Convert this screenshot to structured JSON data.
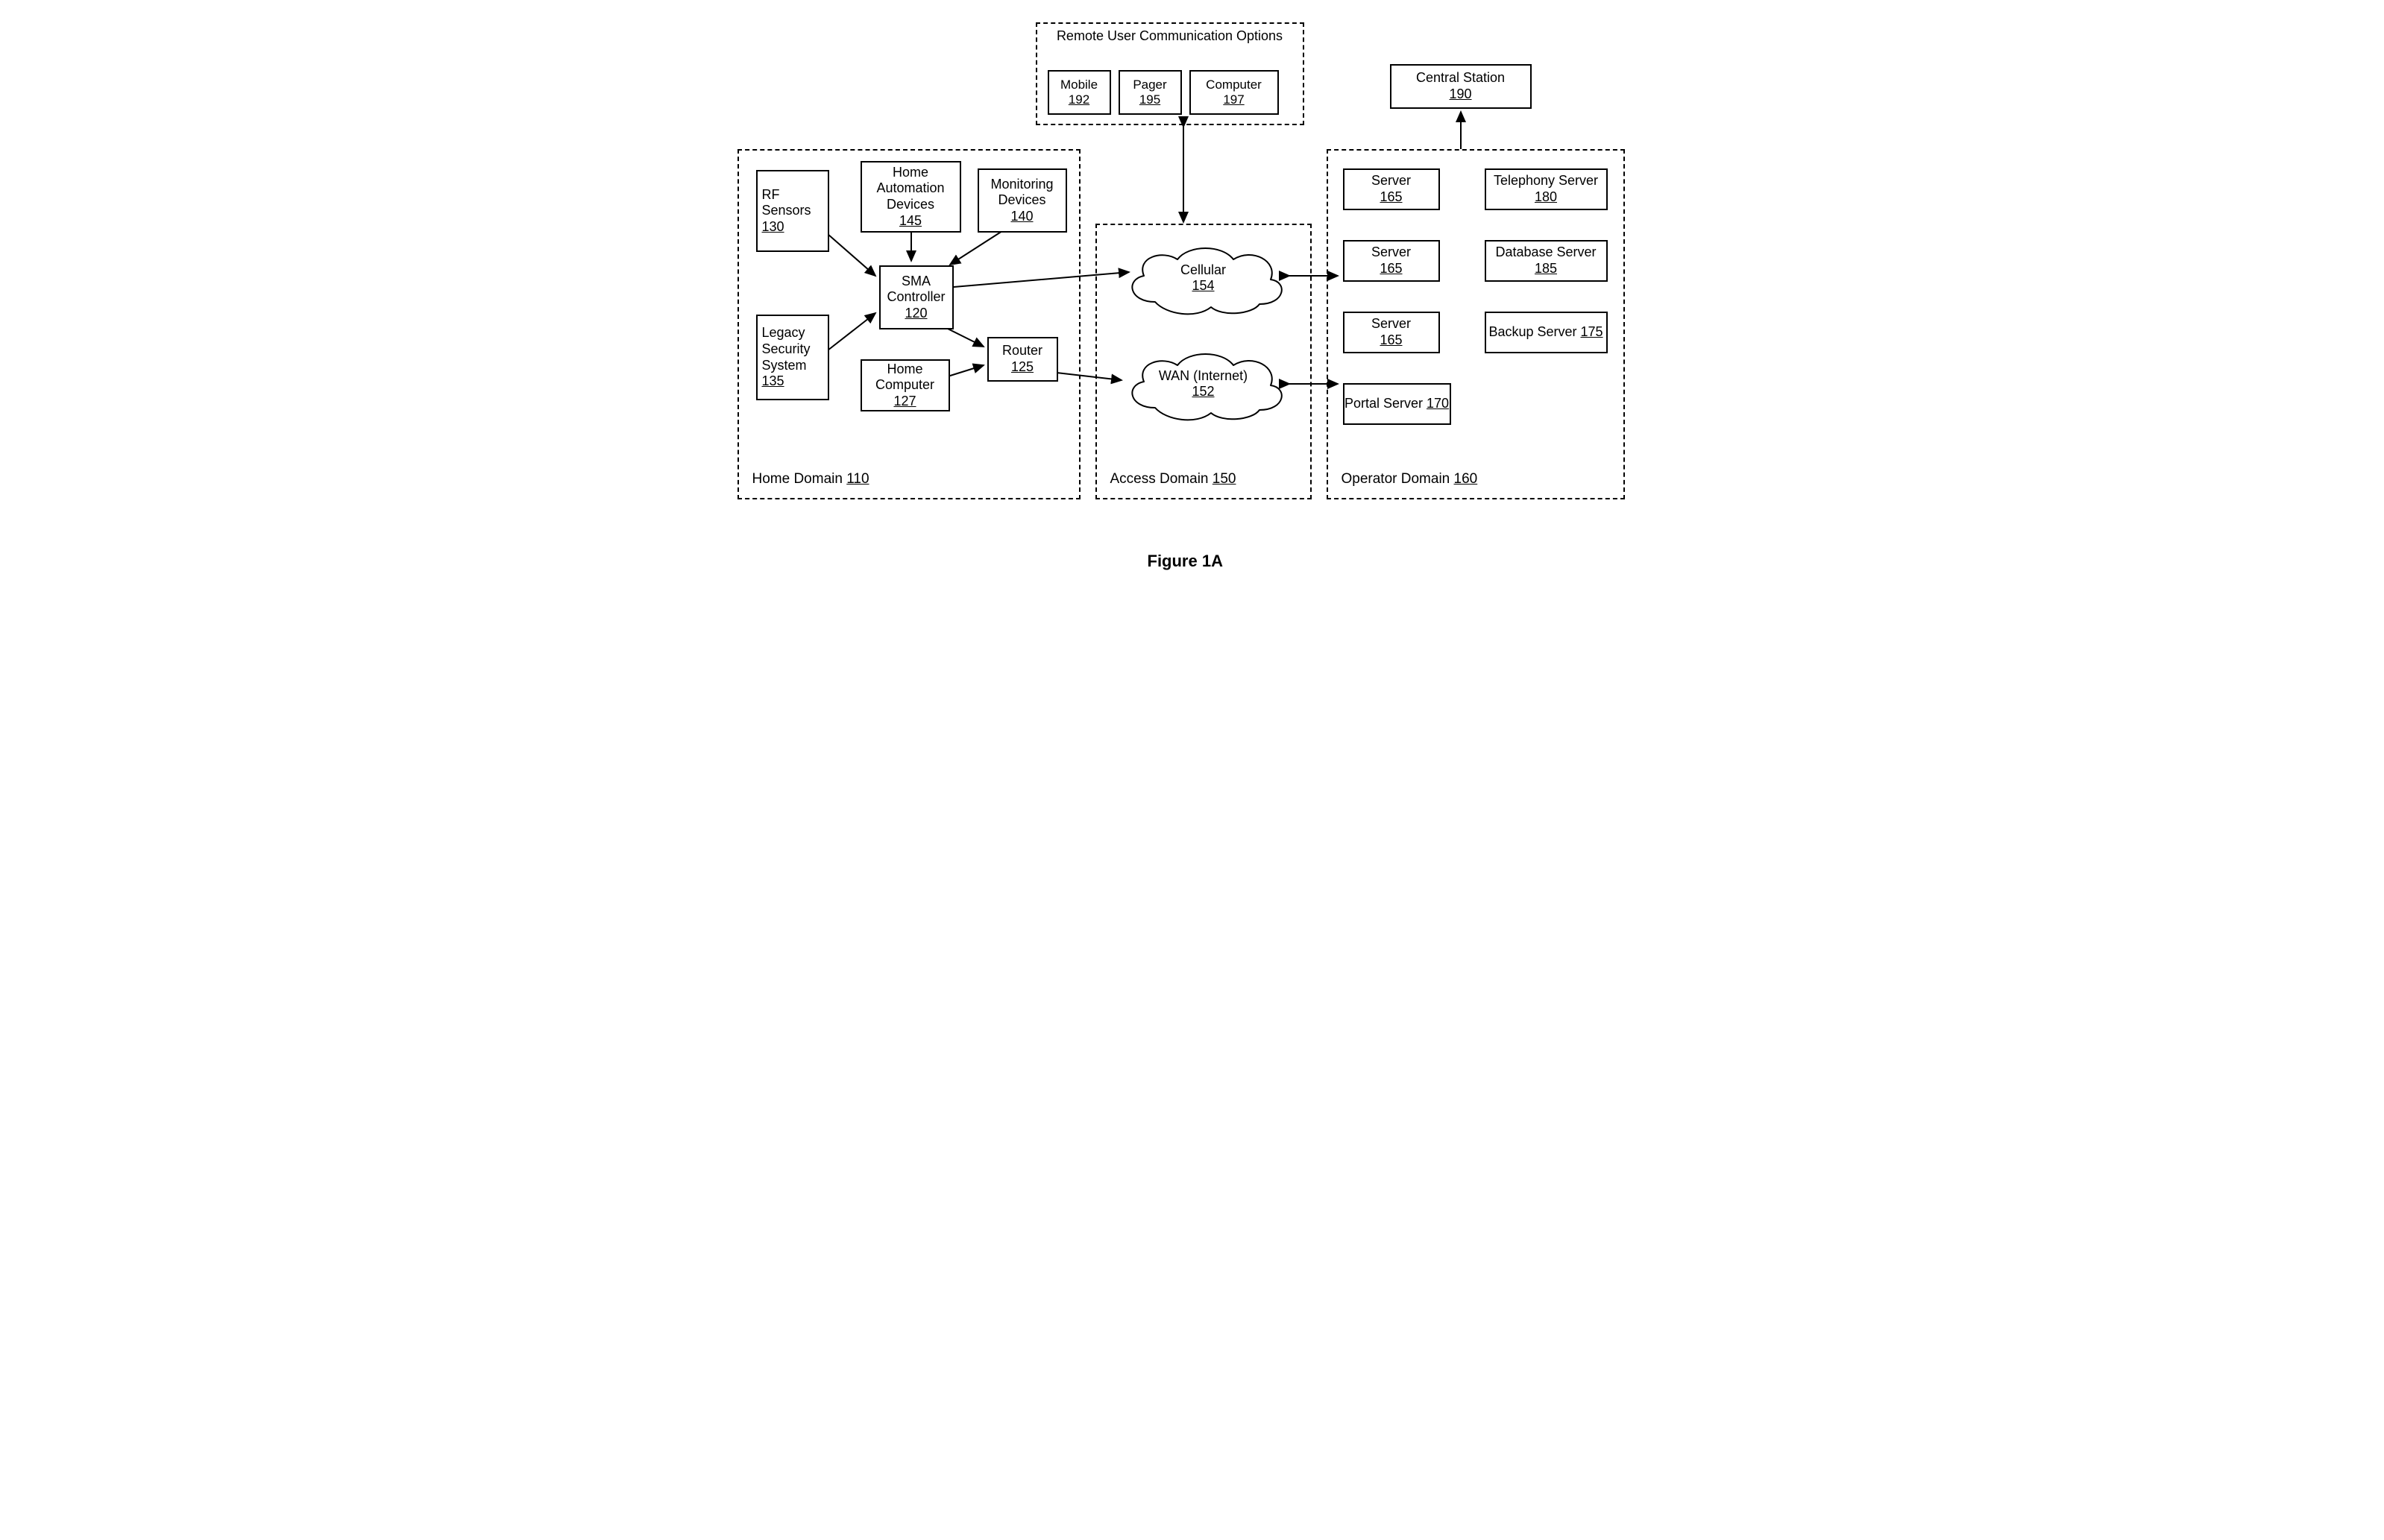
{
  "figure_caption": "Figure 1A",
  "remote_panel": {
    "title": "Remote User Communication Options"
  },
  "remote": {
    "mobile": {
      "label": "Mobile",
      "ref": "192"
    },
    "pager": {
      "label": "Pager",
      "ref": "195"
    },
    "computer": {
      "label": "Computer",
      "ref": "197"
    }
  },
  "central_station": {
    "label": "Central Station",
    "ref": "190"
  },
  "home": {
    "domain_label": "Home Domain ",
    "domain_ref": "110",
    "rf_sensors": {
      "label": "RF Sensors",
      "ref": "130"
    },
    "home_auto": {
      "label": "Home Automation Devices",
      "ref": "145"
    },
    "monitoring": {
      "label": "Monitoring Devices",
      "ref": "140"
    },
    "sma": {
      "label": "SMA Controller",
      "ref": "120"
    },
    "legacy": {
      "label": "Legacy Security System",
      "ref": "135"
    },
    "router": {
      "label": "Router",
      "ref": "125"
    },
    "home_computer": {
      "label": "Home Computer",
      "ref": "127"
    }
  },
  "access": {
    "domain_label": "Access Domain ",
    "domain_ref": "150",
    "cellular": {
      "label": "Cellular",
      "ref": "154"
    },
    "wan": {
      "label": "WAN (Internet)",
      "ref": "152"
    }
  },
  "operator": {
    "domain_label": "Operator Domain ",
    "domain_ref": "160",
    "server1": {
      "label": "Server",
      "ref": "165"
    },
    "server2": {
      "label": "Server",
      "ref": "165"
    },
    "server3": {
      "label": "Server",
      "ref": "165"
    },
    "portal": {
      "label": "Portal Server ",
      "ref": "170"
    },
    "telephony": {
      "label": "Telephony Server ",
      "ref": "180"
    },
    "database": {
      "label": "Database Server ",
      "ref": "185"
    },
    "backup": {
      "label": "Backup Server ",
      "ref": "175"
    }
  }
}
